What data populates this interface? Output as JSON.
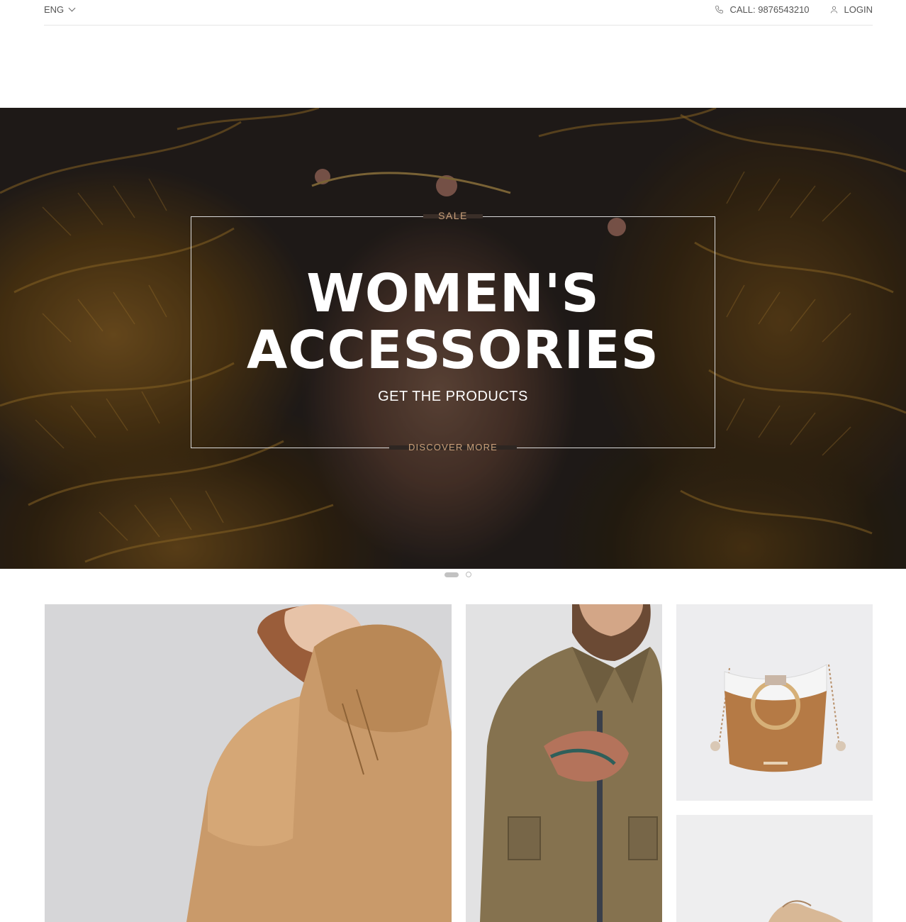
{
  "topbar": {
    "language": "ENG",
    "call_label": "CALL: 9876543210",
    "login_label": "LOGIN"
  },
  "hero": {
    "eyebrow": "SALE",
    "title_line1": "WOMEN'S",
    "title_line2": "ACCESSORIES",
    "subtitle": "GET THE PRODUCTS",
    "cta": "DISCOVER MORE",
    "accent_color": "#c9a07a"
  },
  "slider": {
    "slides": 2,
    "active": 1
  },
  "products": [
    {
      "name": "women-hoodie",
      "icon": "hoodie-image"
    },
    {
      "name": "men-jacket",
      "icon": "jacket-image"
    },
    {
      "name": "handbag",
      "icon": "handbag-image"
    },
    {
      "name": "shoe",
      "icon": "shoe-image"
    }
  ]
}
